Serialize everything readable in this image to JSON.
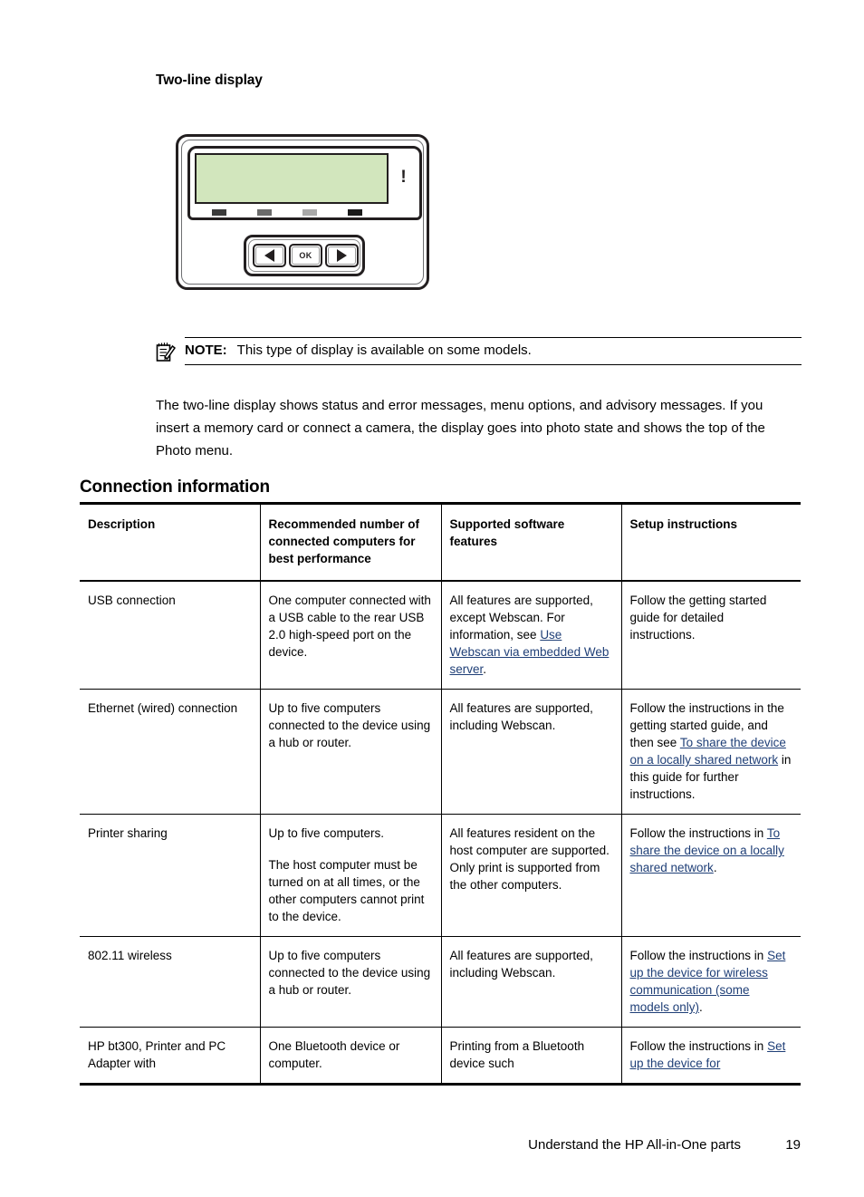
{
  "section": {
    "sub_heading": "Two-line display"
  },
  "device": {
    "name": "two-line-display-control-panel",
    "attention_symbol": "!",
    "buttons": [
      {
        "name": "left-arrow-button",
        "label": "◀"
      },
      {
        "name": "ok-button",
        "label": "OK"
      },
      {
        "name": "right-arrow-button",
        "label": "▶"
      }
    ]
  },
  "note": {
    "icon": "note-pad-pencil-icon",
    "label": "NOTE:",
    "text": "This type of display is available on some models."
  },
  "body_paragraph": "The two-line display shows status and error messages, menu options, and advisory messages. If you insert a memory card or connect a camera, the display goes into photo state and shows the top of the Photo menu.",
  "main_heading": "Connection information",
  "table": {
    "headers": [
      "Description",
      "Recommended number of connected computers for best performance",
      "Supported software features",
      "Setup instructions"
    ],
    "rows": [
      {
        "description": "USB connection",
        "recommended": "One computer connected with a USB cable to the rear USB 2.0 high-speed port on the device.",
        "features_pre": "All features are supported, except Webscan. For information, see ",
        "features_link": "Use Webscan via embedded Web server",
        "features_post": ".",
        "setup_pre": "Follow the getting started guide for detailed instructions.",
        "setup_link": "",
        "setup_post": ""
      },
      {
        "description": "Ethernet (wired) connection",
        "recommended": "Up to five computers connected to the device using a hub or router.",
        "features_pre": "All features are supported, including Webscan.",
        "features_link": "",
        "features_post": "",
        "setup_pre": "Follow the instructions in the getting started guide, and then see ",
        "setup_link": "To share the device on a locally shared network",
        "setup_post": " in this guide for further instructions."
      },
      {
        "description": "Printer sharing",
        "recommended": "Up to five computers.",
        "recommended_2": "The host computer must be turned on at all times, or the other computers cannot print to the device.",
        "features_pre": "All features resident on the host computer are supported. Only print is supported from the other computers.",
        "features_link": "",
        "features_post": "",
        "setup_pre": "Follow the instructions in ",
        "setup_link": "To share the device on a locally shared network",
        "setup_post": "."
      },
      {
        "description": "802.11 wireless",
        "recommended": "Up to five computers connected to the device using a hub or router.",
        "features_pre": "All features are supported, including Webscan.",
        "features_link": "",
        "features_post": "",
        "setup_pre": "Follow the instructions in ",
        "setup_link": "Set up the device for wireless communication (some models only)",
        "setup_post": "."
      },
      {
        "description": "HP bt300, Printer and PC Adapter with",
        "recommended": "One Bluetooth device or computer.",
        "features_pre": "Printing from a Bluetooth device such",
        "features_link": "",
        "features_post": "",
        "setup_pre": "Follow the instructions in ",
        "setup_link": "Set up the device for",
        "setup_post": ""
      }
    ]
  },
  "footer": {
    "title": "Understand the HP All-in-One parts",
    "page_number": "19"
  },
  "colors": {
    "link": "#1f3f77",
    "lcd_screen": "#d2e6bd",
    "rule": "#000000"
  }
}
